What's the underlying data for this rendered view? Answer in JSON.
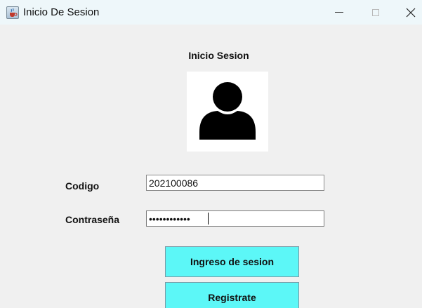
{
  "window": {
    "title": "Inicio De Sesion",
    "controls": {
      "minimize": "minimize",
      "maximize": "maximize",
      "close": "close"
    }
  },
  "form": {
    "heading": "Inicio Sesion",
    "codigo": {
      "label": "Codigo",
      "value": "202100086"
    },
    "password": {
      "label": "Contraseña",
      "value": "••••••••••••"
    },
    "login_button": "Ingreso de sesion",
    "register_button": "Registrate"
  },
  "colors": {
    "titlebar": "#eef7fa",
    "background": "#f0f0f0",
    "button": "#5cf7f7"
  },
  "icons": {
    "app": "java-cup-icon",
    "avatar": "user-silhouette-icon"
  }
}
